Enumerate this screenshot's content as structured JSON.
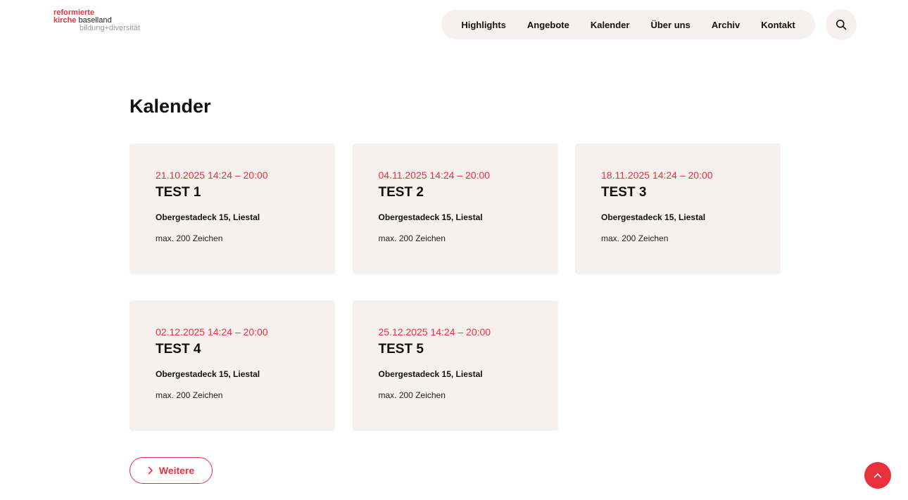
{
  "logo": {
    "line1": "reformierte",
    "line2_red": "kirche",
    "line2_dark": "baselland",
    "line3": "bildung+diversität"
  },
  "nav": {
    "items": [
      "Highlights",
      "Angebote",
      "Kalender",
      "Über uns",
      "Archiv",
      "Kontakt"
    ]
  },
  "search": {
    "icon": "search-icon"
  },
  "main": {
    "title": "Kalender",
    "events": [
      {
        "date": "21.10.2025 14:24 – 20:00",
        "title": "TEST 1",
        "location": "Obergestadeck 15, Liestal",
        "description": "max. 200 Zeichen"
      },
      {
        "date": "04.11.2025 14:24 – 20:00",
        "title": "TEST 2",
        "location": "Obergestadeck 15, Liestal",
        "description": "max. 200 Zeichen"
      },
      {
        "date": "18.11.2025 14:24 – 20:00",
        "title": "TEST 3",
        "location": "Obergestadeck 15, Liestal",
        "description": "max. 200 Zeichen"
      },
      {
        "date": "02.12.2025 14:24 – 20:00",
        "title": "TEST 4",
        "location": "Obergestadeck 15, Liestal",
        "description": "max. 200 Zeichen"
      },
      {
        "date": "25.12.2025 14:24 – 20:00",
        "title": "TEST 5",
        "location": "Obergestadeck 15, Liestal",
        "description": "max. 200 Zeichen"
      }
    ],
    "more_label": "Weitere"
  },
  "colors": {
    "accent": "#e8313b",
    "card_bg": "#f6f1ee"
  }
}
